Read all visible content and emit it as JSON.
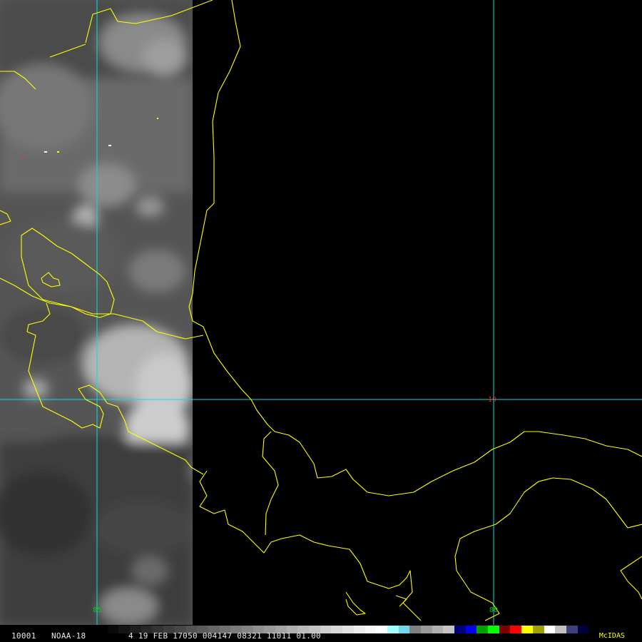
{
  "image": {
    "satellite": "NOAA-18",
    "frame_id": "10001",
    "status_line": "4 19 FEB 17050 004147 08321 11011 01.00",
    "software": "McIDAS"
  },
  "grid": {
    "longitudes": [
      {
        "value": "85",
        "color": "#00d000"
      },
      {
        "value": "80",
        "color": "#00d000"
      }
    ],
    "latitudes": [
      {
        "value": "10",
        "color": "#ff2020"
      }
    ],
    "line_color": "#00e0e0",
    "coast_color": "#ffff00"
  },
  "colors": {
    "background": "#000000",
    "swath_dark": "#2a2a2a",
    "swath_light": "#6e6e6e",
    "cloud": "#c8c8c8"
  },
  "colorbar": {
    "segments": [
      "#000000",
      "#0a0a0a",
      "#141414",
      "#1e1e1e",
      "#282828",
      "#333333",
      "#3d3d3d",
      "#474747",
      "#525252",
      "#5c5c5c",
      "#666666",
      "#717171",
      "#7b7b7b",
      "#858585",
      "#909090",
      "#9a9a9a",
      "#a4a4a4",
      "#afafaf",
      "#b9b9b9",
      "#c3c3c3",
      "#cecece",
      "#d8d8d8",
      "#e2e2e2",
      "#ededed",
      "#f7f7f7",
      "#ffffff",
      "#a0ffff",
      "#70d8e8",
      "#808080",
      "#9a9a9a",
      "#b0b0b0",
      "#c4c4c4",
      "#000080",
      "#0000ff",
      "#00a000",
      "#00ff00",
      "#800000",
      "#ff0000",
      "#ffff00",
      "#a0a000",
      "#ffffff",
      "#c0c0c0",
      "#404080",
      "#000040"
    ]
  }
}
